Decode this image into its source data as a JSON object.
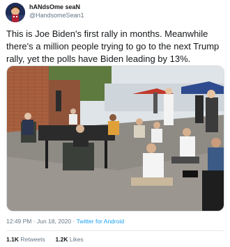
{
  "author": {
    "display_name": "hANdsOme seaN",
    "handle": "@HandsomeSean1",
    "avatar_icon": "profile-avatar-icon"
  },
  "tweet": {
    "text": "This is Joe Biden's first rally in months. Meanwhile there's a million people trying to go to the next Trump rally, yet the polls have Biden leading by 13%.",
    "time": "12:49 PM",
    "separator": "·",
    "date": "Jun 18, 2020",
    "source": "Twitter for Android"
  },
  "engagement": {
    "retweets_count": "1.1K",
    "retweets_label": "Retweets",
    "likes_count": "1.2K",
    "likes_label": "Likes"
  },
  "colors": {
    "link": "#1da1f2",
    "muted": "#657786",
    "text": "#14171a"
  }
}
